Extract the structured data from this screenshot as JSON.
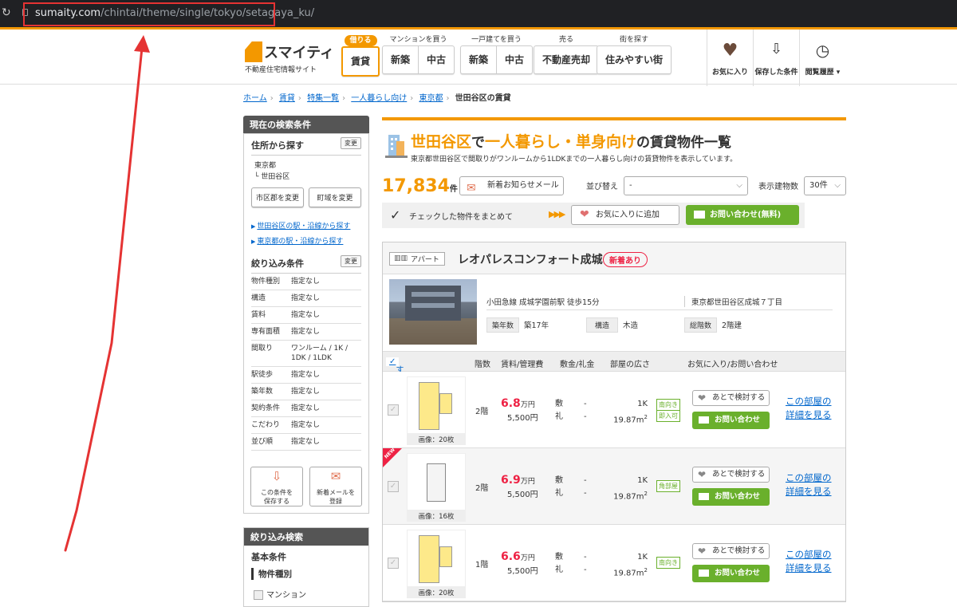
{
  "browser": {
    "url_domain": "sumaity.com",
    "url_path": "/chintai/theme/single/tokyo/setagaya_ku/"
  },
  "header": {
    "logo_name": "スマイティ",
    "logo_sub": "不動産住宅情報サイト",
    "groups": [
      {
        "caption": "借りる",
        "buttons": [
          "賃貸"
        ]
      },
      {
        "caption": "マンションを買う",
        "buttons": [
          "新築",
          "中古"
        ]
      },
      {
        "caption": "一戸建てを買う",
        "buttons": [
          "新築",
          "中古"
        ]
      },
      {
        "caption": "売る",
        "buttons": [
          "不動産売却"
        ]
      },
      {
        "caption": "街を探す",
        "buttons": [
          "住みやすい街"
        ]
      }
    ],
    "right_nav": [
      "お気に入り",
      "保存した条件",
      "閲覧履歴 ▾"
    ]
  },
  "breadcrumb": [
    "ホーム",
    "賃貸",
    "特集一覧",
    "一人暮らし向け",
    "東京都",
    "世田谷区の賃貸"
  ],
  "sidebar": {
    "head": "現在の検索条件",
    "addr_title": "住所から探す",
    "change": "変更",
    "pref": "東京都",
    "city": "└ 世田谷区",
    "btn_city": "市区郡を変更",
    "btn_town": "町域を変更",
    "link1": "世田谷区の駅・沿線から探す",
    "link2": "東京都の駅・沿線から探す",
    "filter_title": "絞り込み条件",
    "filters": [
      {
        "k": "物件種別",
        "v": "指定なし"
      },
      {
        "k": "構造",
        "v": "指定なし"
      },
      {
        "k": "賃料",
        "v": "指定なし"
      },
      {
        "k": "専有面積",
        "v": "指定なし"
      },
      {
        "k": "間取り",
        "v": "ワンルーム / 1K / 1DK / 1LDK"
      },
      {
        "k": "駅徒歩",
        "v": "指定なし"
      },
      {
        "k": "築年数",
        "v": "指定なし"
      },
      {
        "k": "契約条件",
        "v": "指定なし"
      },
      {
        "k": "こだわり",
        "v": "指定なし"
      },
      {
        "k": "並び順",
        "v": "指定なし"
      }
    ],
    "save_line1": "この条件を",
    "save_line2": "保存する",
    "mail_line1": "新着メールを",
    "mail_line2": "登録",
    "head2": "絞り込み検索",
    "basic": "基本条件",
    "ptype": "物件種別",
    "opt_mansion": "マンション"
  },
  "main": {
    "title_area": "世田谷区",
    "title_de": "で",
    "title_theme": "一人暮らし・単身向け",
    "title_rest": "の賃貸物件一覧",
    "desc": "東京都世田谷区で間取りがワンルームから1LDKまでの一人暮らし向けの賃貸物件を表示しています。",
    "count": "17,834",
    "count_unit": "件",
    "mail_btn": "新着お知らせメール",
    "sort_label": "並び替え",
    "sort_value": "-",
    "display_label": "表示建物数",
    "display_value": "30件",
    "check_label": "チェックした物件をまとめて",
    "fav_btn": "お気に入りに追加",
    "inq_btn": "お問い合わせ(無料)"
  },
  "property": {
    "type": "アパート",
    "name": "レオパレスコンフォート成城",
    "new_badge": "新着あり",
    "access": "小田急線 成城学園前駅 徒歩15分",
    "address": "東京都世田谷区成城７丁目",
    "age_label": "築年数",
    "age": "築17年",
    "struct_label": "構造",
    "struct": "木造",
    "floors_label": "総階数",
    "floors": "2階建",
    "cols": {
      "select_all": "すべて選択",
      "floor": "階数",
      "rent": "賃料/管理費",
      "deposit": "敷金/礼金",
      "size": "部屋の広さ",
      "actions": "お気に入り/お問い合わせ"
    },
    "dep_labels": [
      "敷",
      "礼"
    ],
    "later_btn": "あとで検討する",
    "inq_btn": "お問い合わせ",
    "detail_l1": "この部屋の",
    "detail_l2": "詳細を見る",
    "new_tag": "NEW",
    "rooms": [
      {
        "photos": "画像：20枚",
        "floor": "2階",
        "rent": "6.8",
        "unit": "万円",
        "mng": "5,500円",
        "dep": "-",
        "key": "-",
        "layout": "1K",
        "area": "19.87m",
        "badges": [
          "南向き",
          "即入可"
        ]
      },
      {
        "photos": "画像：16枚",
        "floor": "2階",
        "rent": "6.9",
        "unit": "万円",
        "mng": "5,500円",
        "dep": "-",
        "key": "-",
        "layout": "1K",
        "area": "19.87m",
        "badges": [
          "角部屋"
        ]
      },
      {
        "photos": "画像：20枚",
        "floor": "1階",
        "rent": "6.6",
        "unit": "万円",
        "mng": "5,500円",
        "dep": "-",
        "key": "-",
        "layout": "1K",
        "area": "19.87m",
        "badges": [
          "南向き"
        ]
      }
    ]
  }
}
